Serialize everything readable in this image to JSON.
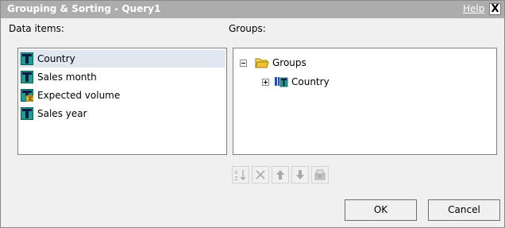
{
  "dialog": {
    "title": "Grouping & Sorting - Query1",
    "help_label": "Help",
    "close_label": "X"
  },
  "data_items": {
    "label": "Data items:",
    "items": [
      {
        "label": "Country",
        "icon": "text-field-icon",
        "selected": true
      },
      {
        "label": "Sales month",
        "icon": "text-field-icon",
        "selected": false
      },
      {
        "label": "Expected volume",
        "icon": "measure-field-icon",
        "selected": false
      },
      {
        "label": "Sales year",
        "icon": "text-field-icon",
        "selected": false
      }
    ]
  },
  "groups": {
    "label": "Groups:",
    "root": {
      "label": "Groups",
      "icon": "folder-icon",
      "expanded": true
    },
    "children": [
      {
        "label": "Country",
        "icon": "group-field-icon",
        "expanded": false
      }
    ]
  },
  "toolbar": {
    "buttons": [
      "sort-icon",
      "delete-icon",
      "move-up-icon",
      "move-down-icon",
      "properties-icon"
    ],
    "enabled": false
  },
  "footer": {
    "ok_label": "OK",
    "cancel_label": "Cancel"
  },
  "colors": {
    "titlebar": "#acacac",
    "dialog_bg": "#f0f0f0",
    "selection": "#dfe7f1",
    "field_blue": "#2a4fa8",
    "field_teal": "#1f9b8f",
    "folder_yellow": "#f2c230"
  }
}
